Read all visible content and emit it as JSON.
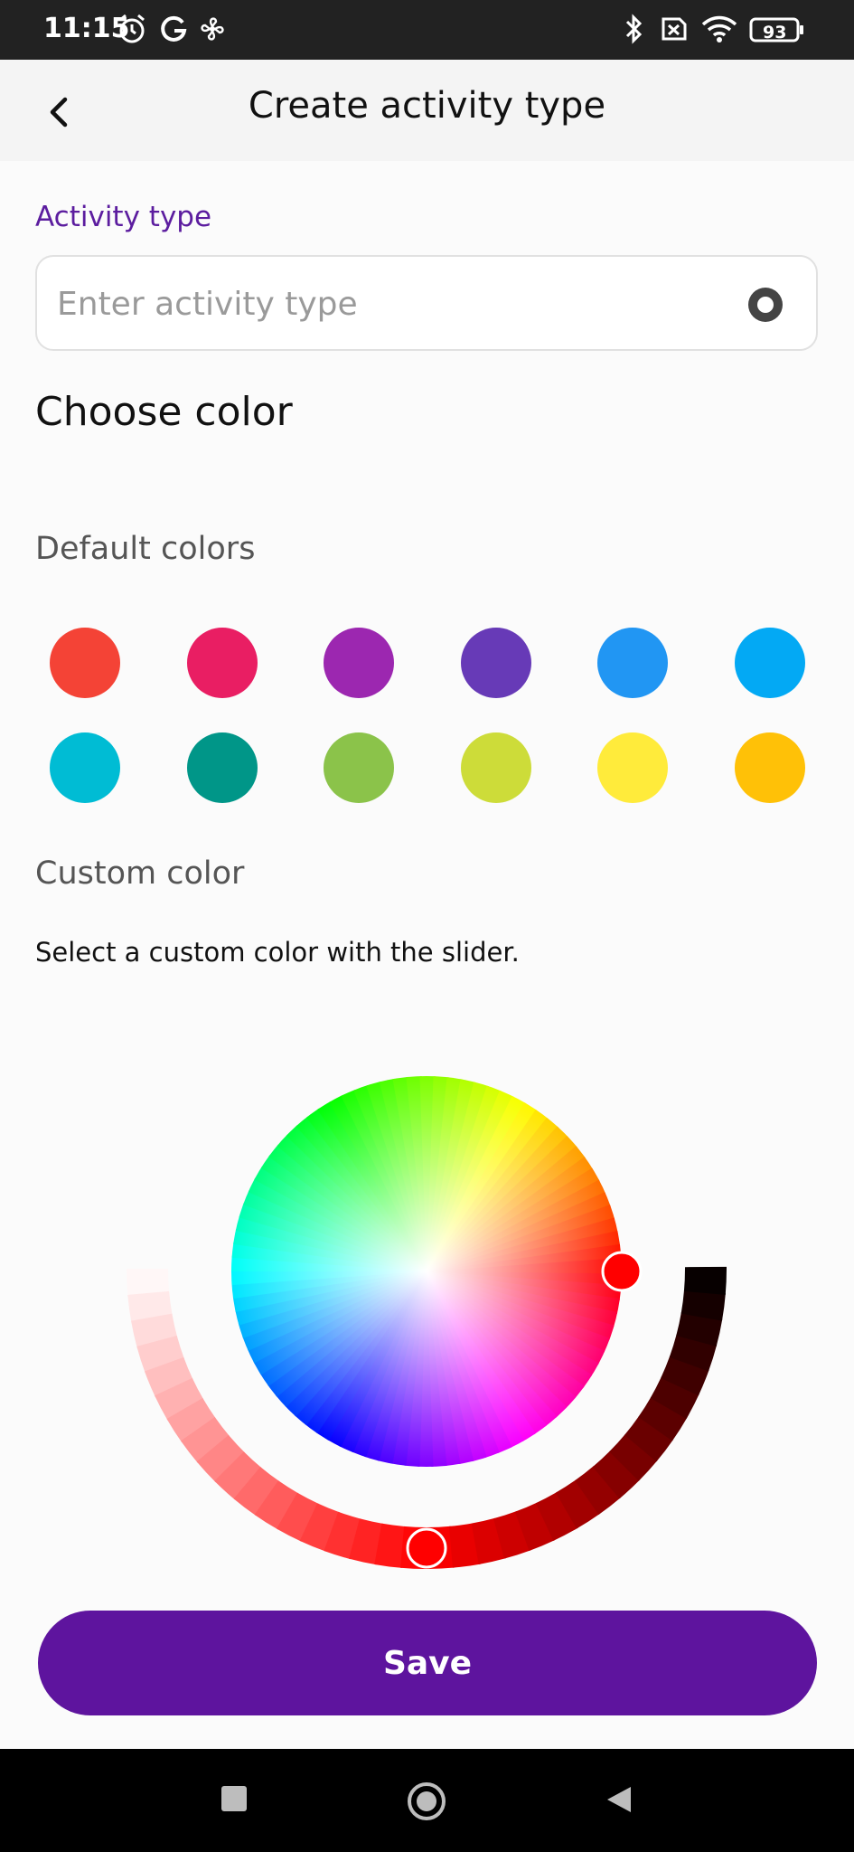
{
  "status_bar": {
    "time": "11:15",
    "battery": "93",
    "icons": [
      "alarm-icon",
      "google-icon",
      "fan-icon",
      "bluetooth-icon",
      "no-sim-icon",
      "wifi-icon",
      "battery-icon"
    ]
  },
  "header": {
    "title": "Create activity type",
    "back_icon": "chevron-left-icon"
  },
  "form": {
    "activity_type_label": "Activity type",
    "activity_type_value": "",
    "activity_type_placeholder": "Enter activity type",
    "input_icon": "radio-icon"
  },
  "color_section": {
    "title": "Choose color",
    "default_title": "Default colors",
    "default_colors": [
      "#f44336",
      "#e91e63",
      "#9c27b0",
      "#673ab7",
      "#2196f3",
      "#03a9f4",
      "#00bcd4",
      "#009688",
      "#8bc34a",
      "#cddc39",
      "#ffeb3b",
      "#ffc107"
    ],
    "custom_title": "Custom color",
    "custom_description": "Select a custom color with the slider.",
    "selected_hue_color": "#ff0000",
    "selected_hue_degrees": 0,
    "shade_position_fraction": 0.5
  },
  "actions": {
    "save_label": "Save"
  },
  "theme": {
    "accent": "#5e149e",
    "label_color": "#5c1d9f"
  },
  "nav_bar": {
    "icons": [
      "recents-icon",
      "home-icon",
      "back-icon"
    ]
  }
}
